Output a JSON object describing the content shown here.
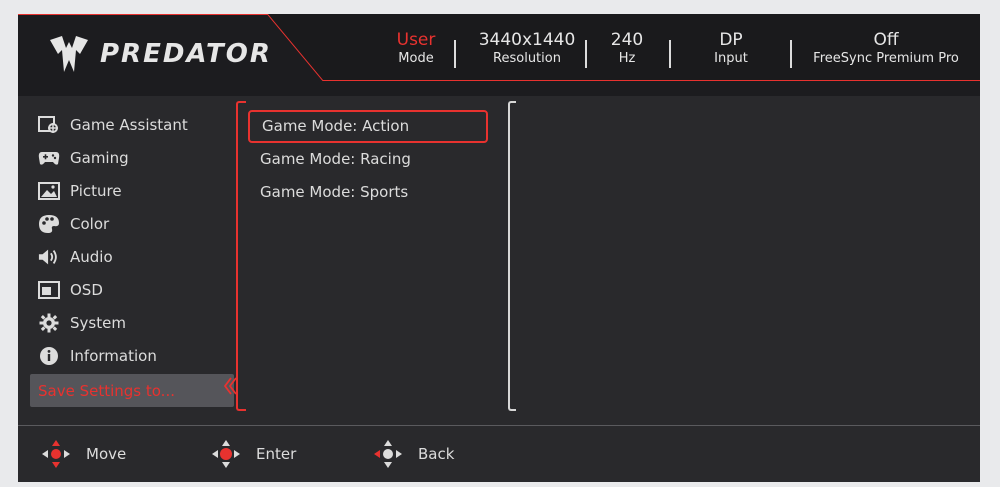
{
  "header": {
    "brand": "PREDATOR",
    "status": [
      {
        "value": "User",
        "label": "Mode",
        "accent": true
      },
      {
        "value": "3440x1440",
        "label": "Resolution",
        "accent": false
      },
      {
        "value": "240",
        "label": "Hz",
        "accent": false
      },
      {
        "value": "DP",
        "label": "Input",
        "accent": false
      },
      {
        "value": "Off",
        "label": "FreeSync Premium Pro",
        "accent": false
      }
    ]
  },
  "nav": {
    "items": [
      {
        "label": "Game Assistant",
        "icon": "crosshair-icon"
      },
      {
        "label": "Gaming",
        "icon": "gamepad-icon"
      },
      {
        "label": "Picture",
        "icon": "picture-icon"
      },
      {
        "label": "Color",
        "icon": "palette-icon"
      },
      {
        "label": "Audio",
        "icon": "speaker-icon"
      },
      {
        "label": "OSD",
        "icon": "osd-icon"
      },
      {
        "label": "System",
        "icon": "gear-icon"
      },
      {
        "label": "Information",
        "icon": "info-icon"
      },
      {
        "label": "Save Settings to...",
        "icon": ""
      }
    ]
  },
  "submenu": {
    "items": [
      "Game Mode: Action",
      "Game Mode: Racing",
      "Game Mode: Sports"
    ]
  },
  "footer": {
    "move": "Move",
    "enter": "Enter",
    "back": "Back"
  },
  "colors": {
    "accent": "#e8322f",
    "panel": "#29292c",
    "header": "#1c1c1f"
  }
}
